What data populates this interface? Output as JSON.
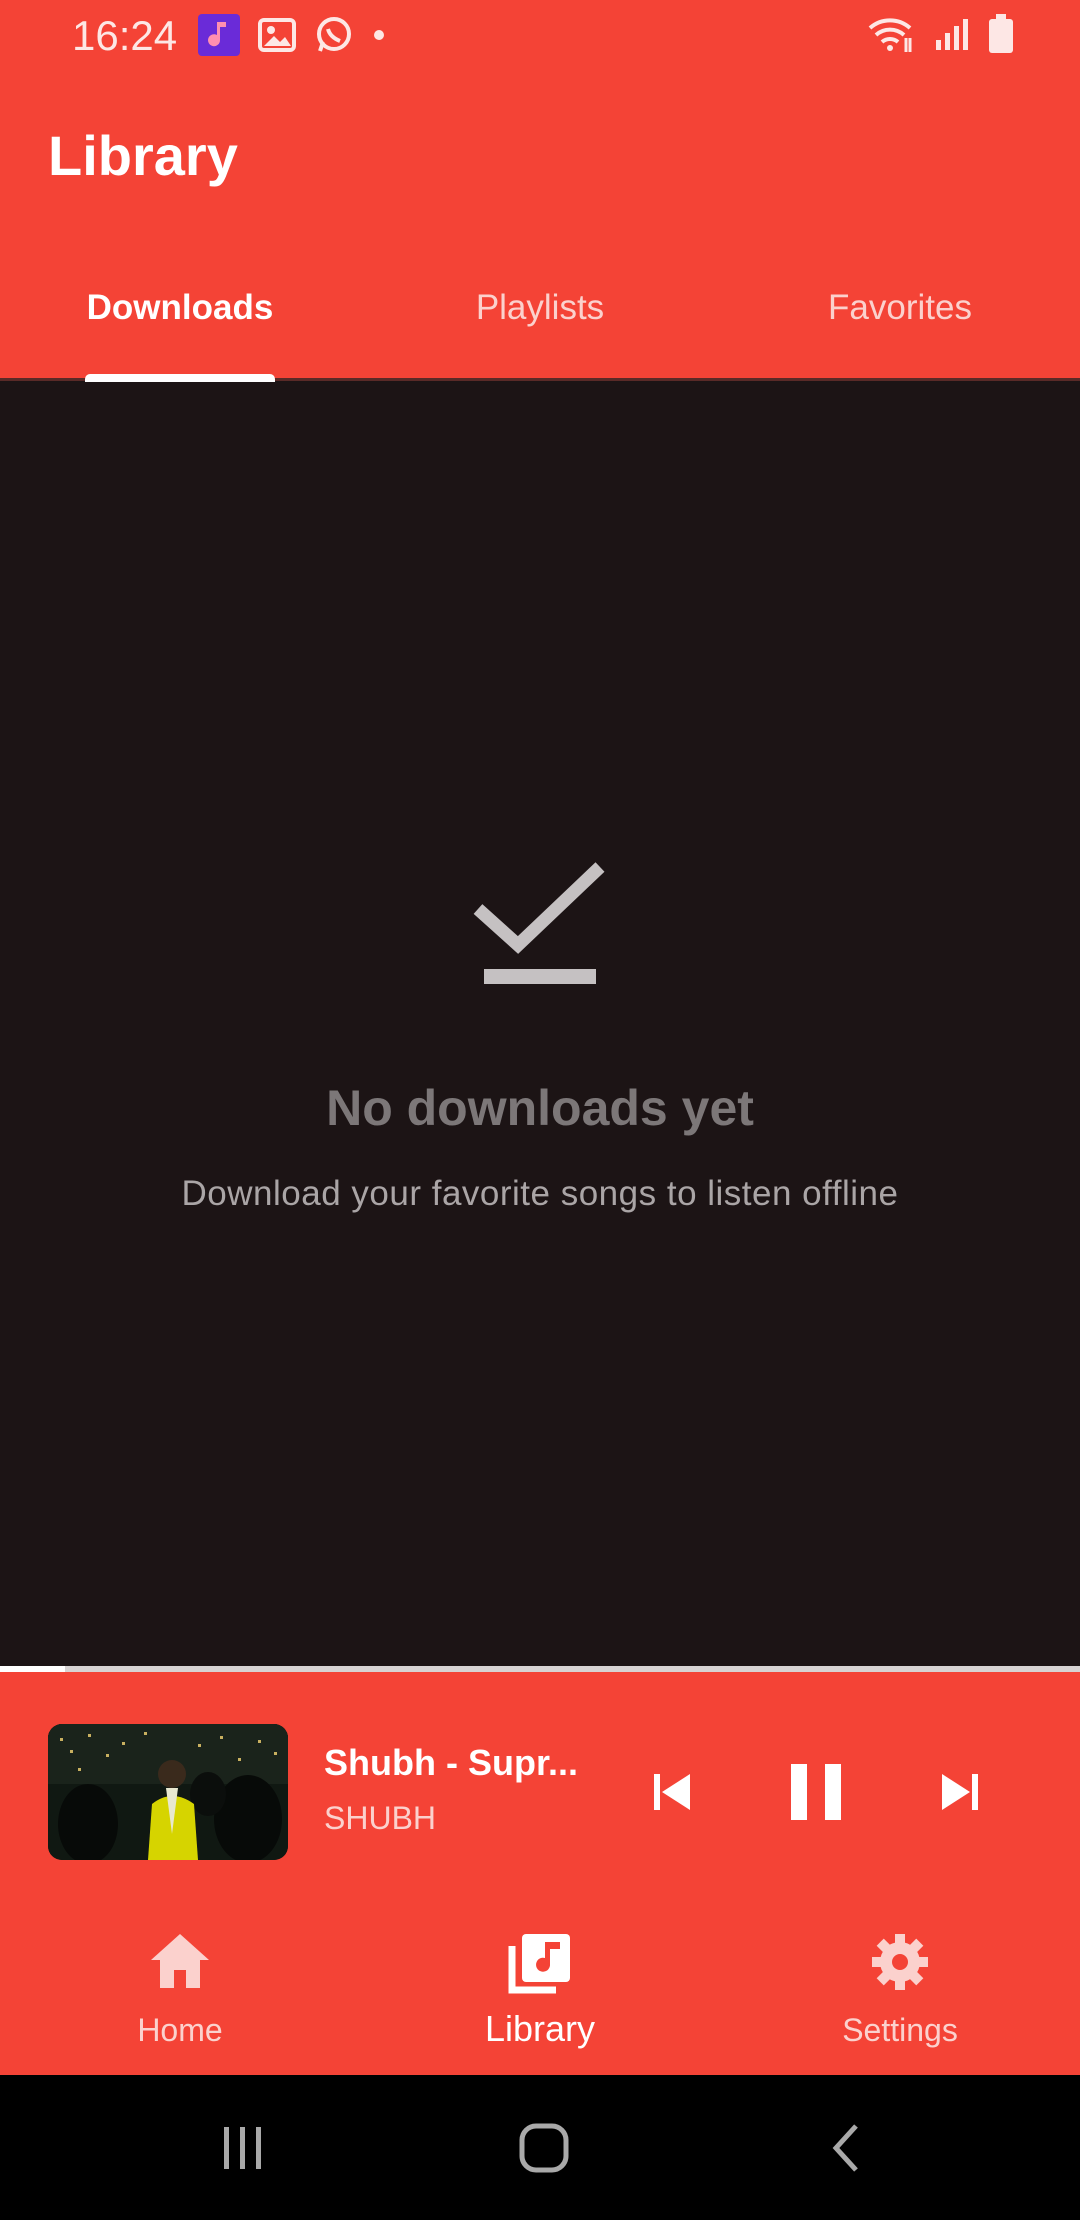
{
  "status_bar": {
    "time": "16:24",
    "icons_left": [
      "music-app-icon",
      "gallery-icon",
      "whatsapp-icon",
      "dot-icon"
    ],
    "icons_right": [
      "wifi-icon",
      "signal-icon",
      "battery-icon"
    ]
  },
  "app_bar": {
    "title": "Library"
  },
  "tabs": [
    {
      "label": "Downloads",
      "active": true
    },
    {
      "label": "Playlists",
      "active": false
    },
    {
      "label": "Favorites",
      "active": false
    }
  ],
  "empty_state": {
    "icon": "download-done-icon",
    "title": "No downloads yet",
    "subtitle": "Download your favorite songs to listen offline"
  },
  "playback": {
    "progress_fraction": 0.06
  },
  "mini_player": {
    "title": "Shubh - Supr...",
    "artist": "SHUBH",
    "controls": [
      "skip-previous-icon",
      "pause-icon",
      "skip-next-icon"
    ]
  },
  "bottom_nav": [
    {
      "label": "Home",
      "icon": "home-icon",
      "active": false
    },
    {
      "label": "Library",
      "icon": "library-music-icon",
      "active": true
    },
    {
      "label": "Settings",
      "icon": "gear-icon",
      "active": false
    }
  ],
  "system_nav": [
    "recents-icon",
    "home-button-icon",
    "back-icon"
  ],
  "colors": {
    "primary": "#f44336",
    "background": "#1c1415",
    "muted_text": "#7c7778",
    "system_bar": "#000000"
  }
}
